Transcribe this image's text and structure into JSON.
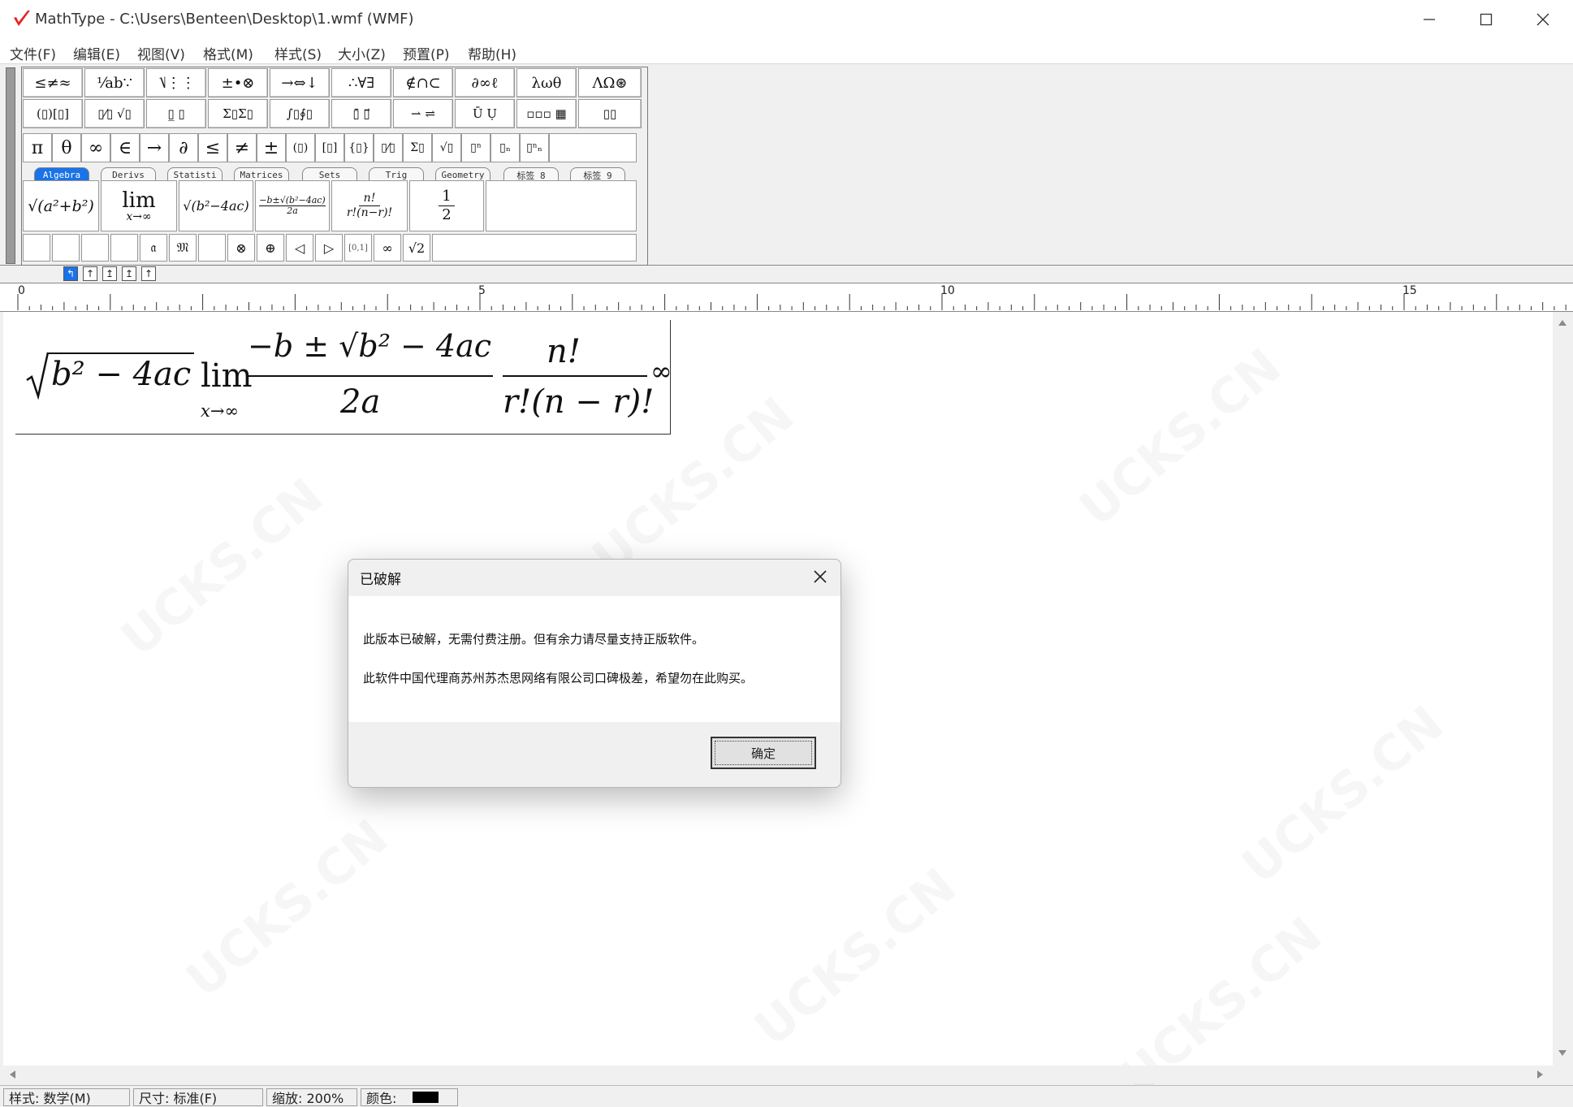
{
  "window": {
    "title": "MathType - C:\\Users\\Benteen\\Desktop\\1.wmf (WMF)",
    "accent": "#e8232a"
  },
  "menu": [
    "文件(F)",
    "编辑(E)",
    "视图(V)",
    "格式(M)",
    "样式(S)",
    "大小(Z)",
    "预置(P)",
    "帮助(H)"
  ],
  "palette_row1": [
    "≤≠≈",
    "⅟ab∵",
    "⎷⋮⋮",
    "±•⊗",
    "→⇔↓",
    "∴∀∃",
    "∉∩⊂",
    "∂∞ℓ",
    "λωθ",
    "ΛΩ⊛"
  ],
  "palette_row2": [
    "(▯)[▯]",
    "▯⁄▯ √▯",
    "▯̲ ▯",
    "Σ▯Σ▯",
    "∫▯∮▯",
    "▯̄ ▯⃗",
    "⇀ ⇌",
    "Ū Ụ",
    "▫▫▫ ▦",
    "▯▯"
  ],
  "symbols_row": [
    "π",
    "θ",
    "∞",
    "∈",
    "→",
    "∂",
    "≤",
    "≠",
    "±",
    "(▯)",
    "[▯]",
    "{▯}",
    "▯⁄▯",
    "Σ▯",
    "√▯",
    "▯ⁿ",
    "▯ₙ",
    "▯ⁿₙ"
  ],
  "tabs": [
    "Algebra",
    "Derivs",
    "Statisti",
    "Matrices",
    "Sets",
    "Trig",
    "Geometry",
    "标签 8",
    "标签 9"
  ],
  "templates": {
    "t1": "√(a²+b²)",
    "t2_top": "lim",
    "t2_bottom": "x→∞",
    "t3": "√(b²−4ac)",
    "t4_top": "−b±√(b²−4ac)",
    "t4_bottom": "2a",
    "t5_top": "n!",
    "t5_bottom": "r!(n−r)!",
    "t6_top": "1",
    "t6_bottom": "2"
  },
  "small_row": [
    "",
    "",
    "",
    "",
    "𝔞",
    "𝔐",
    "",
    "⊗",
    "⊕",
    "◁",
    "▷",
    "[0,1]",
    "∞",
    "√2"
  ],
  "nudges": [
    "↰",
    "↑",
    "↥",
    "↥",
    "↑"
  ],
  "ruler": {
    "labels": [
      "0",
      "5",
      "10",
      "15"
    ]
  },
  "equation": {
    "sqrt1": "b² − 4ac",
    "lim": "lim",
    "lim_sub": "x→∞",
    "frac1_num": "−b ± √b² − 4ac",
    "frac1_den": "2a",
    "frac2_num": "n!",
    "frac2_den": "r!(n − r)!",
    "tail": "∞"
  },
  "dialog": {
    "title": "已破解",
    "line1": "此版本已破解，无需付费注册。但有余力请尽量支持正版软件。",
    "line2": "此软件中国代理商苏州苏杰思网络有限公司口碑极差，希望勿在此购买。",
    "ok": "确定"
  },
  "status": {
    "style": "样式: 数学(M)",
    "size": "尺寸: 标准(F)",
    "zoom": "缩放: 200%",
    "color_label": "颜色:",
    "color_value": "#000000"
  },
  "watermark": "UCKS.CN"
}
